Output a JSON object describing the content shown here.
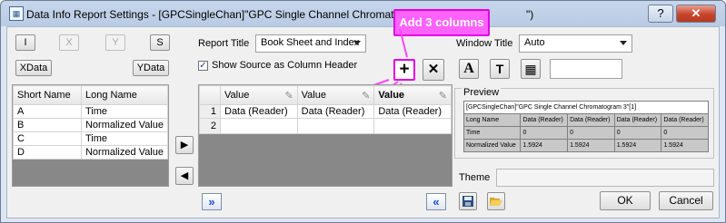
{
  "window": {
    "title": "Data Info Report Settings - [GPCSingleChan]\"GPC Single Channel Chromatogram 3\"!(A\"Ti",
    "title_tail": "\")",
    "help_label": "?",
    "close_label": "✕"
  },
  "axis_buttons": {
    "i": "I",
    "x": "X",
    "y": "Y",
    "s": "S",
    "xdata": "XData",
    "ydata": "YData"
  },
  "left_table": {
    "headers": [
      "Short Name",
      "Long Name"
    ],
    "rows": [
      {
        "short": "A",
        "long": "Time"
      },
      {
        "short": "B",
        "long": "Normalized Value"
      },
      {
        "short": "C",
        "long": "Time"
      },
      {
        "short": "D",
        "long": "Normalized Value"
      }
    ]
  },
  "report_title": {
    "label": "Report Title",
    "value": "Book Sheet and Index"
  },
  "show_source": {
    "label": "Show Source as Column Header",
    "checked": true
  },
  "toolbar": {
    "add": "+",
    "remove": "✕"
  },
  "annotation": {
    "text": "Add 3 columns",
    "color": "#ff62ff"
  },
  "mid_table": {
    "headers": [
      "Value",
      "Value",
      "Value"
    ],
    "rows": [
      {
        "num": "1",
        "cells": [
          "Data (Reader)",
          "Data (Reader)",
          "Data (Reader)"
        ]
      },
      {
        "num": "2",
        "cells": [
          "",
          "",
          ""
        ]
      }
    ]
  },
  "window_title": {
    "label": "Window Title",
    "value": "Auto"
  },
  "format_buttons": {
    "font": "A",
    "text": "T",
    "grid": "▦"
  },
  "preview": {
    "label": "Preview",
    "header": "[GPCSingleChan]\"GPC Single Channel Chromatogram 3\"[1]",
    "rows": [
      [
        "Long Name",
        "Data (Reader)",
        "Data (Reader)",
        "Data (Reader)",
        "Data (Reader)"
      ],
      [
        "Time",
        "0",
        "0",
        "0",
        "0"
      ],
      [
        "Normalized Value",
        "1.5924",
        "1.5924",
        "1.5924",
        "1.5924"
      ]
    ]
  },
  "theme": {
    "label": "Theme",
    "value": ""
  },
  "nav": {
    "right": "▶",
    "left": "◀",
    "expand": "»",
    "collapse": "«"
  },
  "footer": {
    "ok": "OK",
    "cancel": "Cancel"
  }
}
